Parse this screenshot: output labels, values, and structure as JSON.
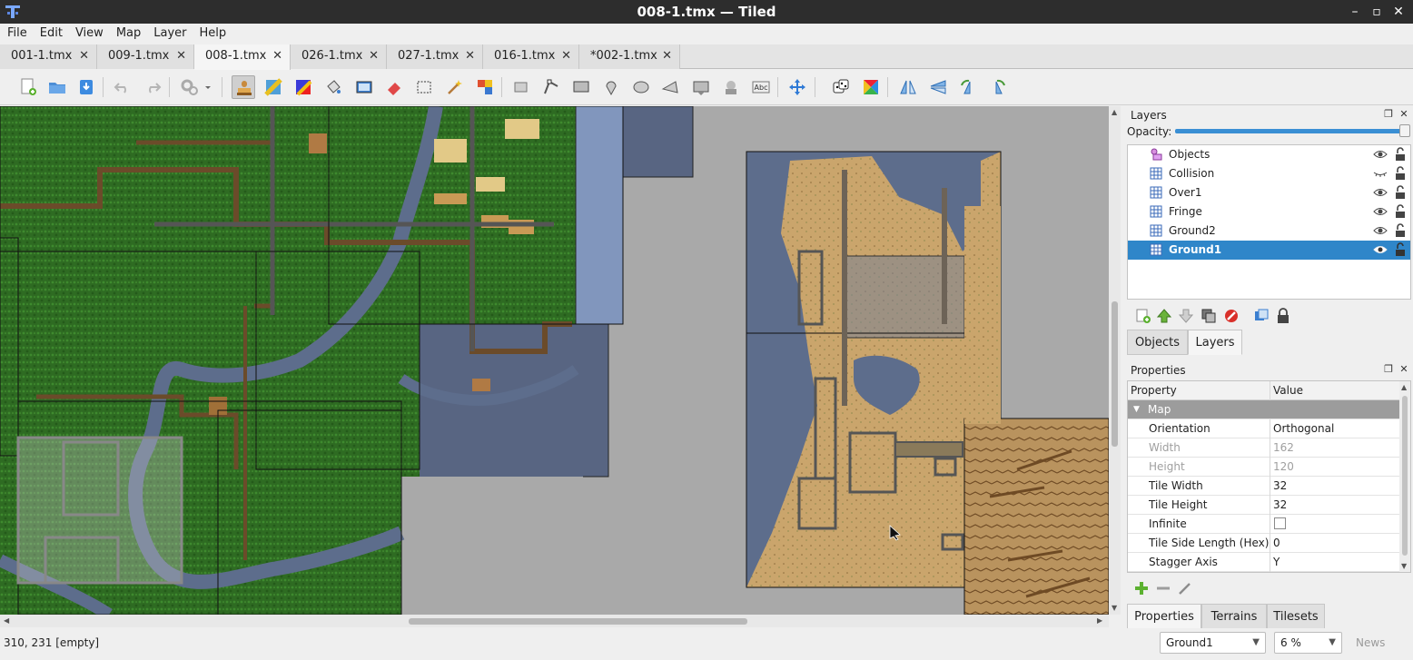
{
  "window": {
    "title": "008-1.tmx — Tiled",
    "minimize": "–",
    "maximize": "▫",
    "close": "✕"
  },
  "menu": [
    "File",
    "Edit",
    "View",
    "Map",
    "Layer",
    "Help"
  ],
  "tabs": [
    {
      "label": "001-1.tmx",
      "active": false
    },
    {
      "label": "009-1.tmx",
      "active": false
    },
    {
      "label": "008-1.tmx",
      "active": true
    },
    {
      "label": "026-1.tmx",
      "active": false
    },
    {
      "label": "027-1.tmx",
      "active": false
    },
    {
      "label": "016-1.tmx",
      "active": false
    },
    {
      "label": "*002-1.tmx",
      "active": false
    }
  ],
  "tab_close_glyph": "✕",
  "layers_panel": {
    "title": "Layers",
    "opacity_label": "Opacity:",
    "opacity_value": 1.0,
    "layers": [
      {
        "name": "Objects",
        "type": "object",
        "visible": true,
        "locked": false
      },
      {
        "name": "Collision",
        "type": "tile",
        "visible": false,
        "locked": false
      },
      {
        "name": "Over1",
        "type": "tile",
        "visible": true,
        "locked": false
      },
      {
        "name": "Fringe",
        "type": "tile",
        "visible": true,
        "locked": false
      },
      {
        "name": "Ground2",
        "type": "tile",
        "visible": true,
        "locked": false
      },
      {
        "name": "Ground1",
        "type": "tile",
        "visible": true,
        "locked": false,
        "selected": true
      }
    ],
    "tabs": [
      "Objects",
      "Layers"
    ],
    "active_tab": "Layers"
  },
  "properties_panel": {
    "title": "Properties",
    "columns": [
      "Property",
      "Value"
    ],
    "group": "Map",
    "rows": [
      {
        "name": "Orientation",
        "value": "Orthogonal",
        "disabled": false
      },
      {
        "name": "Width",
        "value": "162",
        "disabled": true
      },
      {
        "name": "Height",
        "value": "120",
        "disabled": true
      },
      {
        "name": "Tile Width",
        "value": "32",
        "disabled": false
      },
      {
        "name": "Tile Height",
        "value": "32",
        "disabled": false
      },
      {
        "name": "Infinite",
        "value": "",
        "checkbox": true,
        "checked": false,
        "disabled": false
      },
      {
        "name": "Tile Side Length (Hex)",
        "value": "0",
        "disabled": false
      },
      {
        "name": "Stagger Axis",
        "value": "Y",
        "disabled": false
      }
    ],
    "bottom_tabs": [
      "Properties",
      "Terrains",
      "Tilesets"
    ],
    "active_bottom_tab": "Properties"
  },
  "status": {
    "coords": "310, 231 [empty]",
    "layer_combo": "Ground1",
    "zoom_combo": "6 %",
    "news": "News"
  },
  "colors": {
    "selection": "#2f86c9",
    "forest": "#2f6e22",
    "water": "#5b6e8e",
    "sand": "#c9a86c",
    "canvas_bg": "#a9a9a9"
  }
}
